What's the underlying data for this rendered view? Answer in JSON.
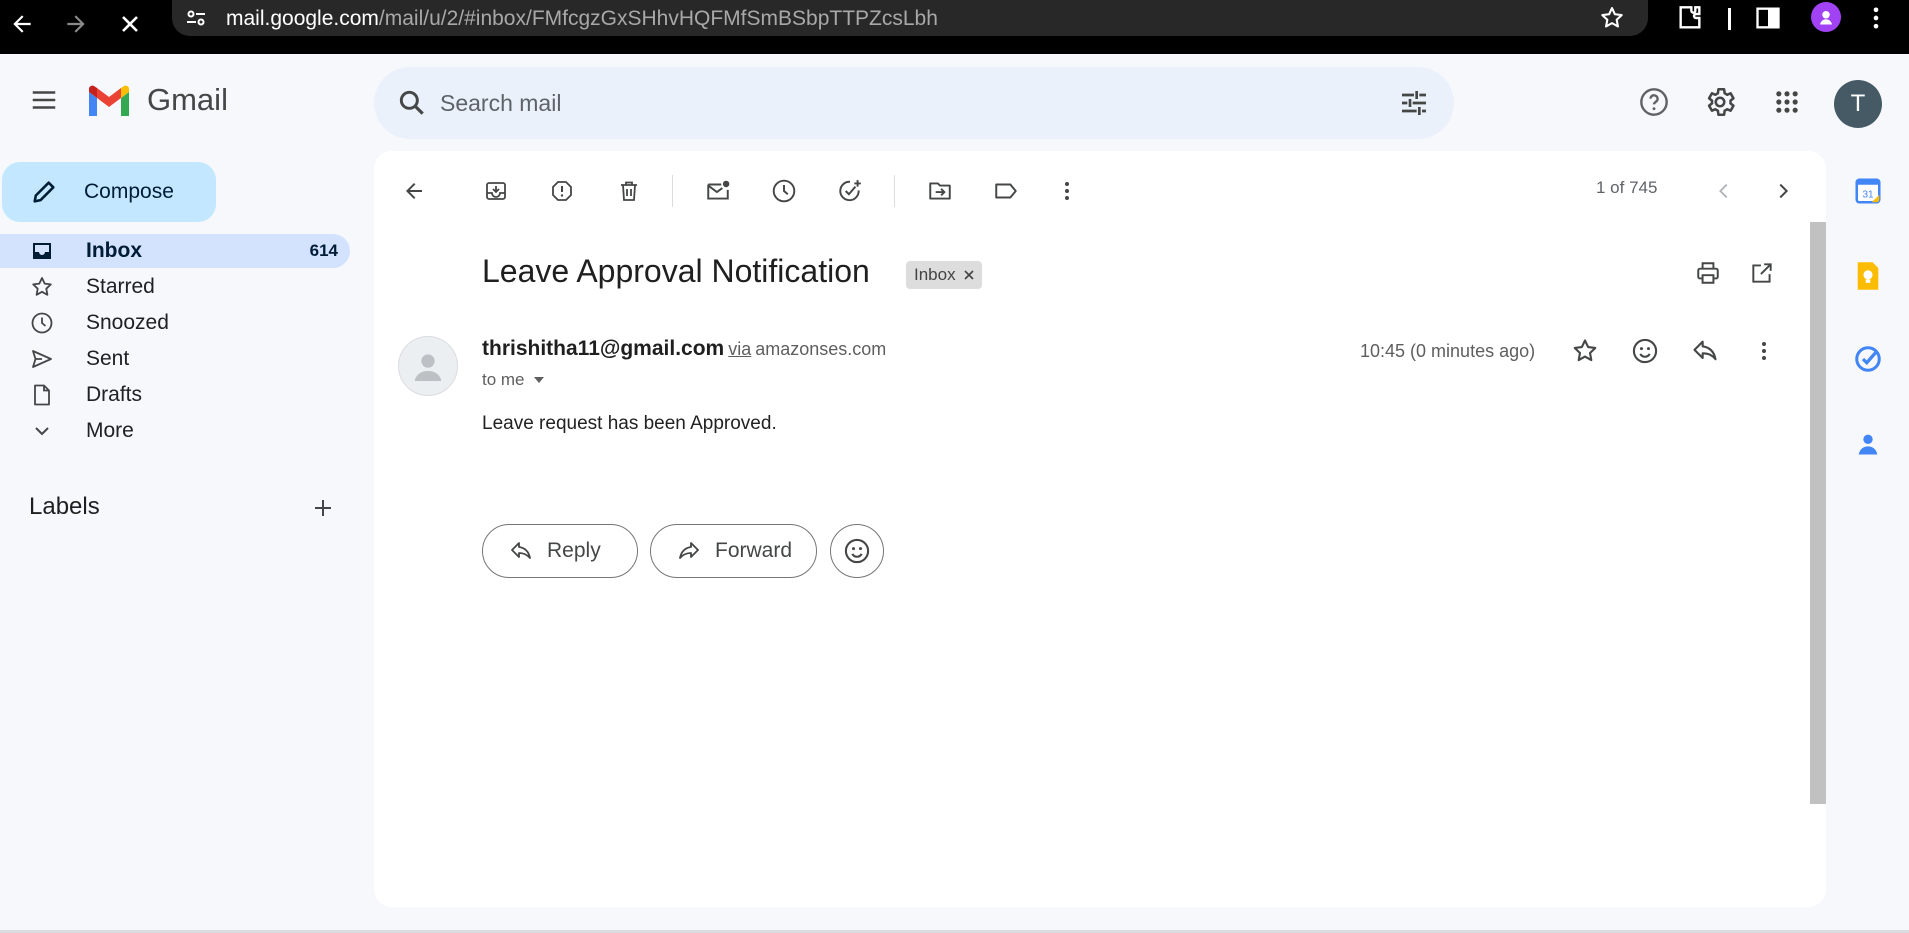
{
  "browser": {
    "url_host": "mail.google.com",
    "url_path": "/mail/u/2/#inbox/FMfcgzGxSHhvHQFMfSmBSbpTTPZcsLbh"
  },
  "app": {
    "name": "Gmail"
  },
  "search": {
    "placeholder": "Search mail"
  },
  "header": {
    "avatar_initial": "T"
  },
  "sidebar": {
    "compose_label": "Compose",
    "items": [
      {
        "label": "Inbox",
        "count": "614",
        "icon": "inbox-icon",
        "active": true
      },
      {
        "label": "Starred",
        "icon": "star-icon"
      },
      {
        "label": "Snoozed",
        "icon": "clock-icon"
      },
      {
        "label": "Sent",
        "icon": "send-icon"
      },
      {
        "label": "Drafts",
        "icon": "draft-icon"
      },
      {
        "label": "More",
        "icon": "chevron-down-icon"
      }
    ],
    "labels_title": "Labels"
  },
  "toolbar": {
    "pager": "1 of 745"
  },
  "message": {
    "subject": "Leave Approval Notification",
    "label_chip": "Inbox",
    "sender_email": "thrishitha11@gmail.com",
    "via": "via",
    "via_domain": "amazonses.com",
    "recipient": "to me",
    "timestamp": "10:45 (0 minutes ago)",
    "body": "Leave request has been Approved."
  },
  "actions": {
    "reply": "Reply",
    "forward": "Forward"
  },
  "colors": {
    "sidebar_active": "#d3e3fd",
    "compose": "#c2e7ff",
    "search_bg": "#eaf1fb",
    "page_bg": "#f6f8fc"
  }
}
